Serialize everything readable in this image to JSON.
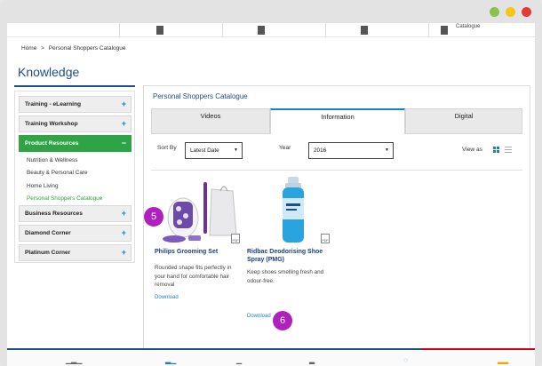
{
  "window": {
    "dots": [
      {
        "name": "green-dot",
        "color": "#8bc34a"
      },
      {
        "name": "yellow-dot",
        "color": "#f5c518"
      },
      {
        "name": "red-dot",
        "color": "#e53935"
      }
    ]
  },
  "topnav": {
    "catalogue_fragment": "Catalogue"
  },
  "breadcrumb": {
    "home": "Home",
    "separator": ">",
    "current": "Personal Shoppers Catalogue"
  },
  "heading": "Knowledge",
  "sidebar": {
    "items": [
      {
        "label": "Training - eLearning",
        "toggle": "+"
      },
      {
        "label": "Training Workshop",
        "toggle": "+"
      },
      {
        "label": "Product Resources",
        "toggle": "−"
      },
      {
        "label": "Business Resources",
        "toggle": "+"
      },
      {
        "label": "Diamond Corner",
        "toggle": "+"
      },
      {
        "label": "Platinum Corner",
        "toggle": "+"
      }
    ],
    "subitems": [
      "Nutrition & Wellness",
      "Beauty & Personal Care",
      "Home Living",
      "Personal Shoppers Catalogue"
    ]
  },
  "main": {
    "title": "Personal Shoppers Catalogue",
    "tabs": [
      "Videos",
      "Information",
      "Digital"
    ],
    "active_tab": "Information",
    "sort_label": "Sort By",
    "sort_value": "Latest Date",
    "year_label": "Year",
    "year_value": "2016",
    "view_label": "View as",
    "products": [
      {
        "name": "Philips Grooming Set",
        "description": [
          "Rounded shape fits perfectly in",
          "your hand for comfortable hair",
          "removal"
        ],
        "download": "Download",
        "badge": "5"
      },
      {
        "name": [
          "Ridbac Deodorising Shoe",
          "Spray (PMG)"
        ],
        "description": [
          "Keep shoes smelling fresh and",
          "odour-free."
        ],
        "download": "Download",
        "badge": "6"
      }
    ],
    "pdf_label": "PDF"
  },
  "colors": {
    "brand_blue": "#1d4e89",
    "link_blue": "#1c7fc4",
    "active_green": "#2ea445",
    "badge_purple": "#b21fbf",
    "footer_red": "#d0021b"
  }
}
